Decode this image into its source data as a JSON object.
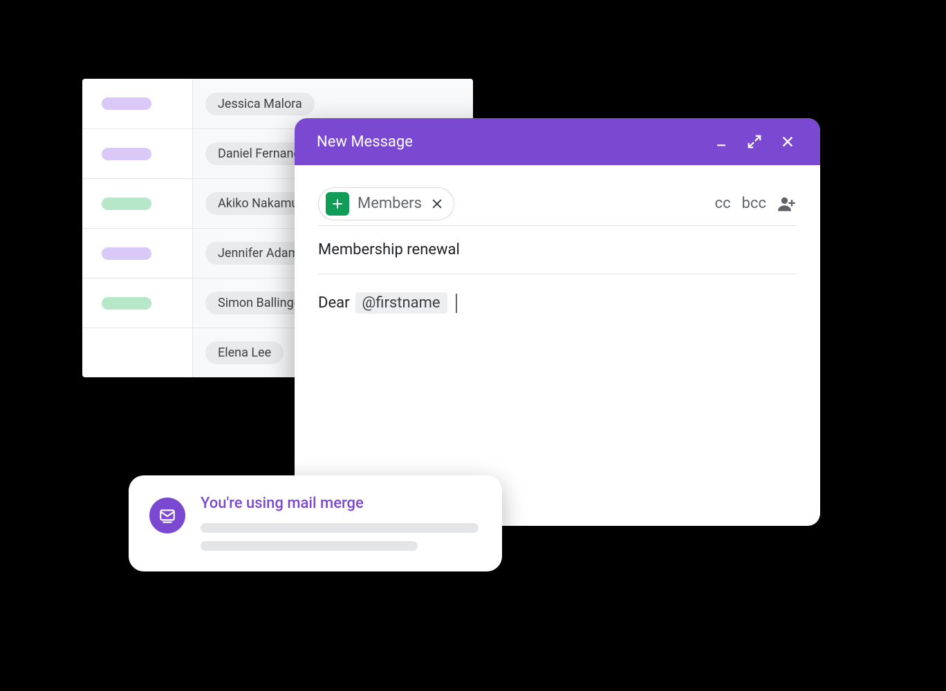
{
  "sheet": {
    "rows": [
      {
        "status_color": "purple",
        "name": "Jessica Malora"
      },
      {
        "status_color": "purple",
        "name": "Daniel Fernandez"
      },
      {
        "status_color": "green",
        "name": "Akiko Nakamura"
      },
      {
        "status_color": "purple",
        "name": "Jennifer Adams"
      },
      {
        "status_color": "green",
        "name": "Simon Ballinger"
      },
      {
        "status_color": "",
        "name": "Elena Lee"
      }
    ]
  },
  "compose": {
    "title": "New Message",
    "recipient_chip": "Members",
    "cc_label": "cc",
    "bcc_label": "bcc",
    "subject": "Membership renewal",
    "body_prefix": "Dear",
    "merge_token": "@firstname"
  },
  "notice": {
    "title": "You're using mail merge"
  }
}
